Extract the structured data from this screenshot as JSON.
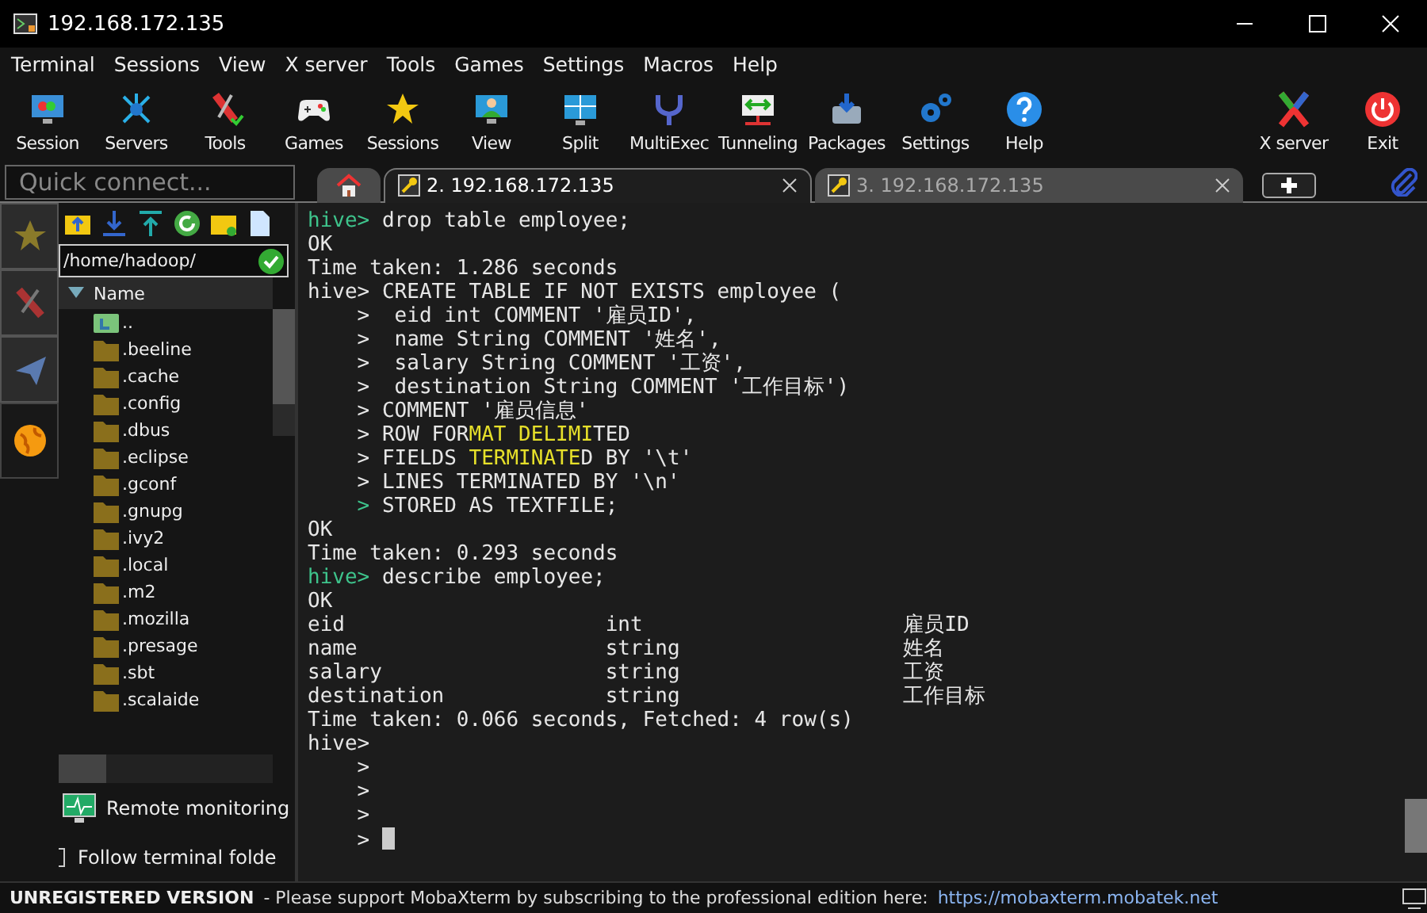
{
  "window": {
    "title": "192.168.172.135"
  },
  "menu": [
    "Terminal",
    "Sessions",
    "View",
    "X server",
    "Tools",
    "Games",
    "Settings",
    "Macros",
    "Help"
  ],
  "toolbar": [
    "Session",
    "Servers",
    "Tools",
    "Games",
    "Sessions",
    "View",
    "Split",
    "MultiExec",
    "Tunneling",
    "Packages",
    "Settings",
    "Help"
  ],
  "toolbar_right": [
    "X server",
    "Exit"
  ],
  "quick_connect": {
    "placeholder": "Quick connect..."
  },
  "tabs": [
    {
      "kind": "home",
      "selected": false
    },
    {
      "kind": "session",
      "label": "2. 192.168.172.135",
      "selected": true
    },
    {
      "kind": "session",
      "label": "3. 192.168.172.135",
      "selected": false
    },
    {
      "kind": "new",
      "selected": false
    }
  ],
  "side_tabs": [
    {
      "selected": false
    },
    {
      "selected": false
    },
    {
      "selected": false
    },
    {
      "selected": true
    }
  ],
  "file_browser": {
    "path": "/home/hadoop/",
    "column": "Name",
    "items": [
      {
        "kind": "parent",
        "name": ".."
      },
      {
        "kind": "folder",
        "name": ".beeline"
      },
      {
        "kind": "folder",
        "name": ".cache"
      },
      {
        "kind": "folder",
        "name": ".config"
      },
      {
        "kind": "folder",
        "name": ".dbus"
      },
      {
        "kind": "folder",
        "name": ".eclipse"
      },
      {
        "kind": "folder",
        "name": ".gconf"
      },
      {
        "kind": "folder",
        "name": ".gnupg"
      },
      {
        "kind": "folder",
        "name": ".ivy2"
      },
      {
        "kind": "folder",
        "name": ".local"
      },
      {
        "kind": "folder",
        "name": ".m2"
      },
      {
        "kind": "folder",
        "name": ".mozilla"
      },
      {
        "kind": "folder",
        "name": ".presage"
      },
      {
        "kind": "folder",
        "name": ".sbt"
      },
      {
        "kind": "folder",
        "name": ".scalaide"
      }
    ],
    "remote_monitoring": "Remote monitoring",
    "follow_terminal_folder": {
      "label": "Follow terminal folde",
      "checked": false
    }
  },
  "terminal": {
    "lines": [
      [
        {
          "kind": "prompt",
          "text": "hive>"
        },
        {
          "kind": "text",
          "text": " drop table employee;"
        }
      ],
      [
        {
          "kind": "text",
          "text": "OK"
        }
      ],
      [
        {
          "kind": "text",
          "text": "Time taken: 1.286 seconds"
        }
      ],
      [
        {
          "kind": "text",
          "text": "hive> CREATE TABLE IF NOT EXISTS employee ("
        }
      ],
      [
        {
          "kind": "text",
          "text": "    >  eid int COMMENT '雇员ID',"
        }
      ],
      [
        {
          "kind": "text",
          "text": "    >  name String COMMENT '姓名',"
        }
      ],
      [
        {
          "kind": "text",
          "text": "    >  salary String COMMENT '工资',"
        }
      ],
      [
        {
          "kind": "text",
          "text": "    >  destination String COMMENT '工作目标')"
        }
      ],
      [
        {
          "kind": "text",
          "text": "    > COMMENT '雇员信息'"
        }
      ],
      [
        {
          "kind": "text",
          "text": "    > ROW FOR"
        },
        {
          "kind": "highlight",
          "text": "MAT DELIMI"
        },
        {
          "kind": "text",
          "text": "TED"
        }
      ],
      [
        {
          "kind": "text",
          "text": "    > FIELDS "
        },
        {
          "kind": "highlight",
          "text": "TERMINATE"
        },
        {
          "kind": "text",
          "text": "D BY '\\t'"
        }
      ],
      [
        {
          "kind": "text",
          "text": "    > LINES TERMINATED BY '\\n'"
        }
      ],
      [
        {
          "kind": "indent_prompt",
          "text": ">"
        },
        {
          "kind": "text",
          "text": " STORED AS TEXTFILE;"
        }
      ],
      [
        {
          "kind": "text",
          "text": "OK"
        }
      ],
      [
        {
          "kind": "text",
          "text": "Time taken: 0.293 seconds"
        }
      ],
      [
        {
          "kind": "prompt",
          "text": "hive>"
        },
        {
          "kind": "text",
          "text": " describe employee;"
        }
      ],
      [
        {
          "kind": "text",
          "text": "OK"
        }
      ],
      [
        {
          "kind": "col1",
          "text": "eid"
        },
        {
          "kind": "col2",
          "text": "int"
        },
        {
          "kind": "col3",
          "text": "雇员ID"
        }
      ],
      [
        {
          "kind": "col1",
          "text": "name"
        },
        {
          "kind": "col2",
          "text": "string"
        },
        {
          "kind": "col3",
          "text": "姓名"
        }
      ],
      [
        {
          "kind": "col1",
          "text": "salary"
        },
        {
          "kind": "col2",
          "text": "string"
        },
        {
          "kind": "col3",
          "text": "工资"
        }
      ],
      [
        {
          "kind": "col1",
          "text": "destination"
        },
        {
          "kind": "col2",
          "text": "string"
        },
        {
          "kind": "col3",
          "text": "工作目标"
        }
      ],
      [
        {
          "kind": "text",
          "text": "Time taken: 0.066 seconds, Fetched: 4 row(s)"
        }
      ],
      [
        {
          "kind": "text",
          "text": "hive>"
        }
      ],
      [
        {
          "kind": "text",
          "text": "    >"
        }
      ],
      [
        {
          "kind": "text",
          "text": "    >"
        }
      ],
      [
        {
          "kind": "text",
          "text": "    >"
        }
      ],
      [
        {
          "kind": "text",
          "text": "    >"
        },
        {
          "kind": "cursor"
        }
      ]
    ]
  },
  "status_bar": {
    "badge": "UNREGISTERED VERSION",
    "message": "-  Please support MobaXterm by subscribing to the professional edition here:",
    "link": "https://mobaxterm.mobatek.net"
  }
}
